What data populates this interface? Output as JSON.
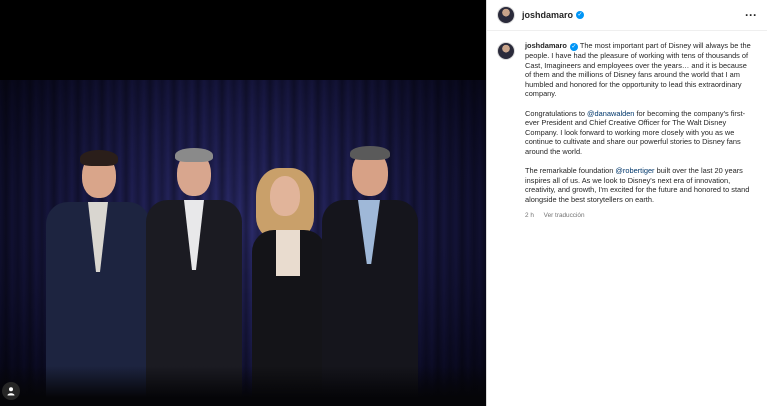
{
  "post": {
    "username": "joshdamaro",
    "verified_mark": "✓",
    "more_glyph": "···",
    "caption": {
      "p1": "The most important part of Disney will always be the people. I have had the pleasure of working with tens of thousands of Cast, Imagineers and employees over the years… and it is because of them and the millions of Disney fans around the world that I am humbled and honored for the opportunity to lead this extraordinary company.",
      "p2_before": "Congratulations to ",
      "p2_mention": "@danawalden",
      "p2_after": " for becoming the company's first-ever President and Chief Creative Officer for The Walt Disney Company.  I look forward to working more closely with you as we continue to cultivate and share our powerful stories to Disney fans around the world.",
      "p3_before": "The remarkable foundation ",
      "p3_mention": "@robertiger",
      "p3_after": " built over the last 20 years inspires all of us. As we look to Disney's next era of innovation, creativity, and growth, I'm excited for the future and honored to stand alongside the best storytellers on earth."
    },
    "time_ago": "2 h",
    "translate_label": "Ver traducción"
  },
  "icons": {
    "user_tag": "person-icon",
    "verified": "verified-badge-icon",
    "more": "more-options-icon"
  },
  "colors": {
    "verified": "#0095f6",
    "mention": "#00376b",
    "backdrop": "#1a1a48"
  }
}
